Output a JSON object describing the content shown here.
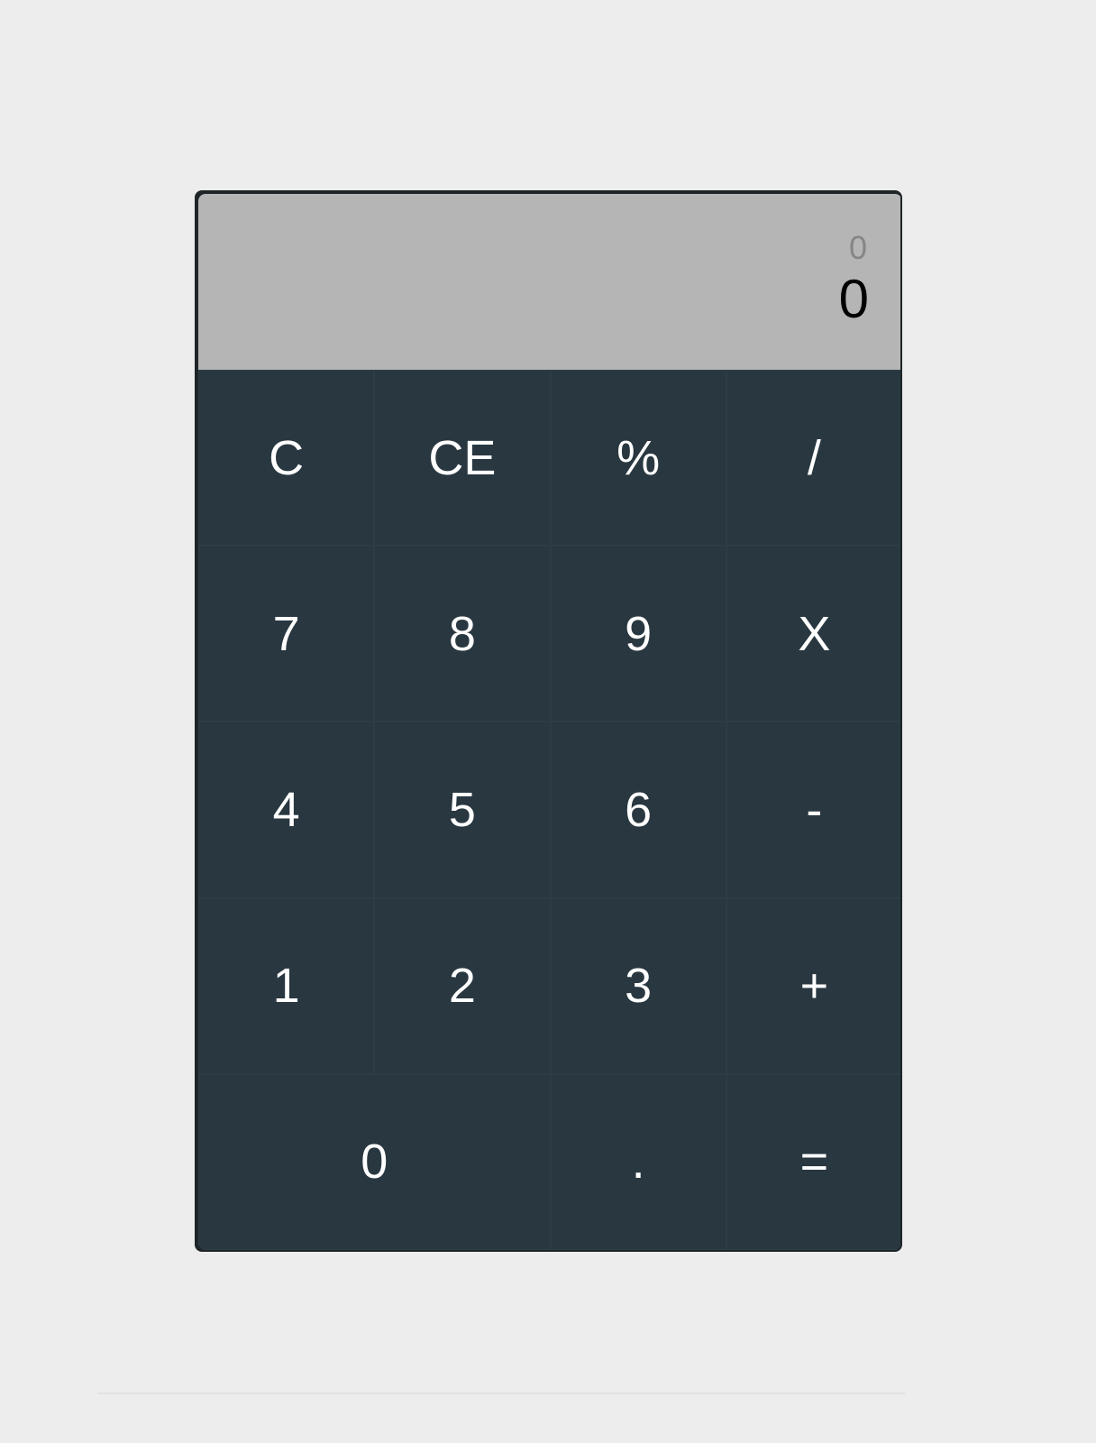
{
  "display": {
    "history": "0",
    "current": "0"
  },
  "keys": {
    "clear": "C",
    "clear_entry": "CE",
    "percent": "%",
    "divide": "/",
    "seven": "7",
    "eight": "8",
    "nine": "9",
    "multiply": "X",
    "four": "4",
    "five": "5",
    "six": "6",
    "subtract": "-",
    "one": "1",
    "two": "2",
    "three": "3",
    "add": "+",
    "zero": "0",
    "decimal": ".",
    "equals": "="
  },
  "colors": {
    "page_background": "#ededed",
    "display_background": "#b5b5b5",
    "keypad_background": "#293740",
    "key_text": "#ffffff",
    "history_text": "#868686",
    "current_text": "#000000"
  }
}
